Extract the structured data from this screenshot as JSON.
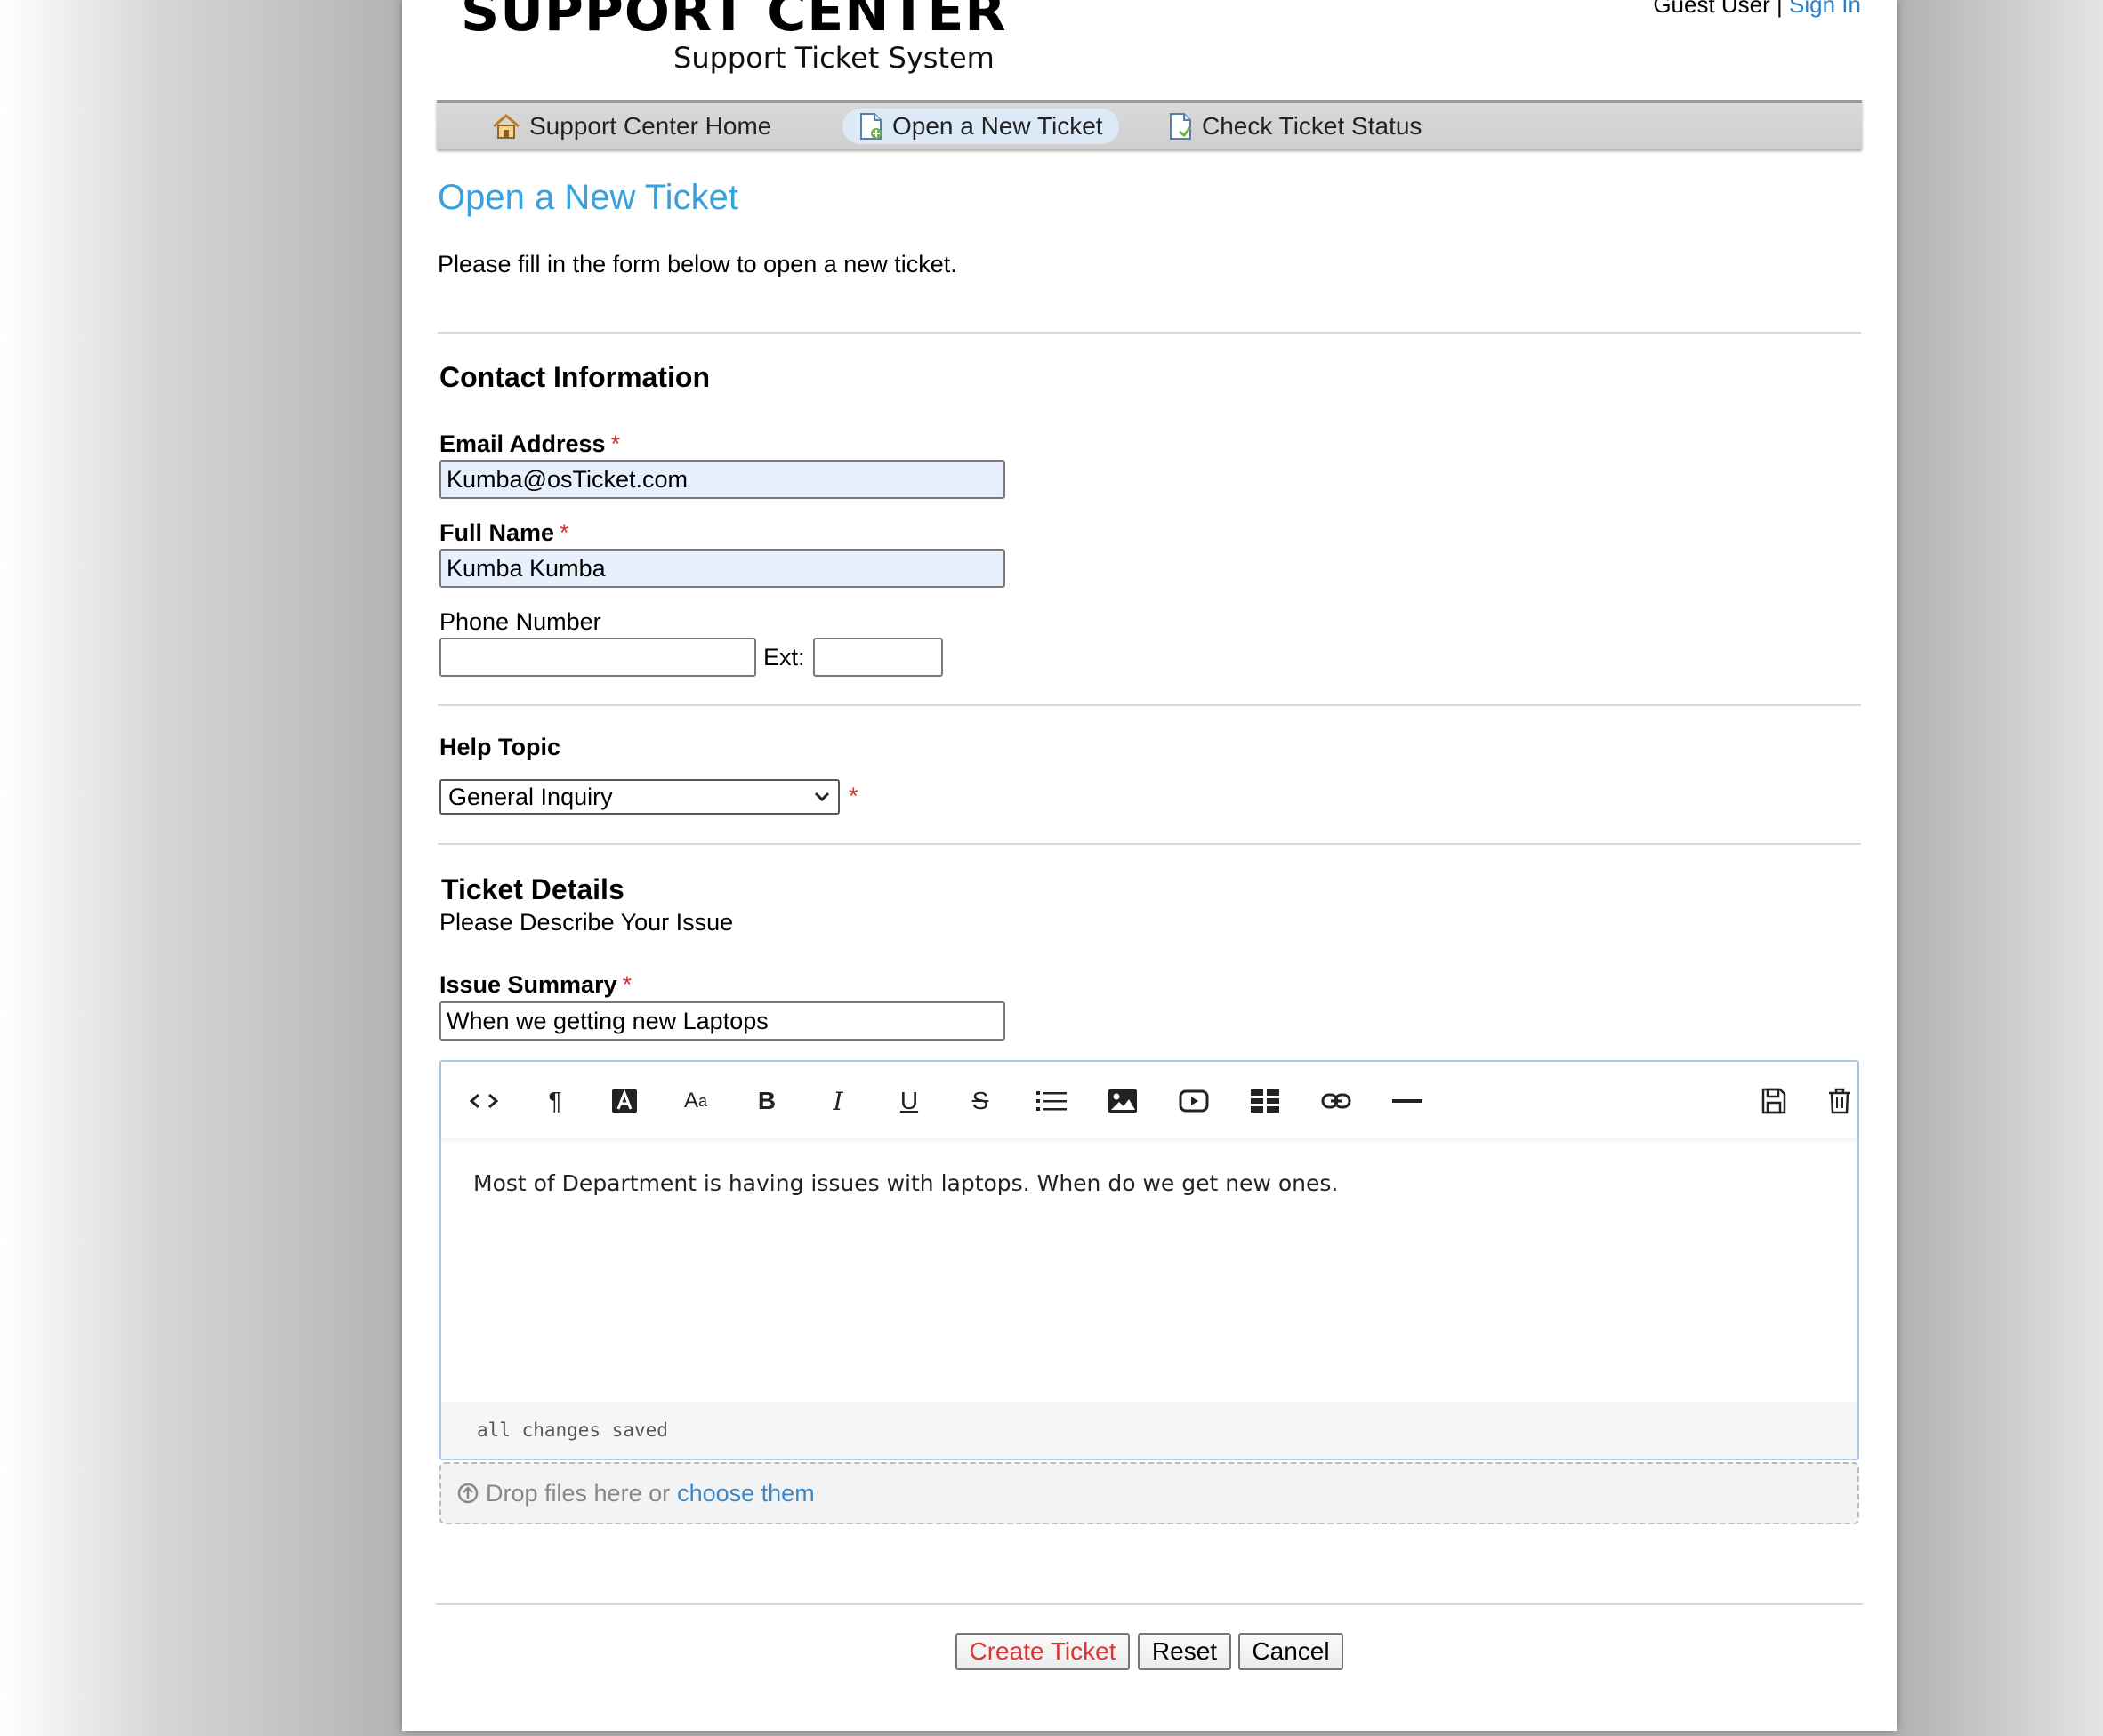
{
  "header": {
    "logo_title": "SUPPORT CENTER",
    "logo_subtitle": "Support Ticket System",
    "user_label": "Guest User",
    "separator": "|",
    "sign_in": "Sign In"
  },
  "nav": {
    "items": [
      {
        "label": "Support Center Home",
        "icon": "home-icon"
      },
      {
        "label": "Open a New Ticket",
        "icon": "new-ticket-icon",
        "active": true
      },
      {
        "label": "Check Ticket Status",
        "icon": "ticket-status-icon"
      }
    ]
  },
  "page": {
    "title": "Open a New Ticket",
    "intro": "Please fill in the form below to open a new ticket."
  },
  "contact": {
    "section_title": "Contact Information",
    "email_label": "Email Address",
    "email_value": "Kumba@osTicket.com",
    "name_label": "Full Name",
    "name_value": "Kumba Kumba",
    "phone_label": "Phone Number",
    "phone_value": "",
    "ext_label": "Ext:",
    "ext_value": "",
    "required_mark": "*"
  },
  "help_topic": {
    "section_title": "Help Topic",
    "selected": "General Inquiry",
    "required_mark": "*"
  },
  "ticket_details": {
    "section_title": "Ticket Details",
    "subtitle": "Please Describe Your Issue",
    "summary_label": "Issue Summary",
    "summary_value": "When we getting new Laptops",
    "required_mark": "*",
    "editor_text": "Most of Department is having issues with laptops. When do we get new ones.",
    "editor_status": "all changes saved",
    "toolbar": [
      "html-icon",
      "paragraph-icon",
      "text-color-icon",
      "font-size-icon",
      "bold-icon",
      "italic-icon",
      "underline-icon",
      "strikethrough-icon",
      "list-icon",
      "image-icon",
      "video-icon",
      "table-icon",
      "link-icon",
      "horizontal-rule-icon",
      "save-draft-icon",
      "delete-draft-icon"
    ],
    "dropzone_text": "Drop files here or",
    "dropzone_link": "choose them"
  },
  "buttons": {
    "create": "Create Ticket",
    "reset": "Reset",
    "cancel": "Cancel"
  },
  "colors": {
    "title_blue": "#3aa0e0",
    "link_blue": "#2a7fc9",
    "required_red": "#d9302a",
    "autofill_bg": "#e8f0fe"
  }
}
